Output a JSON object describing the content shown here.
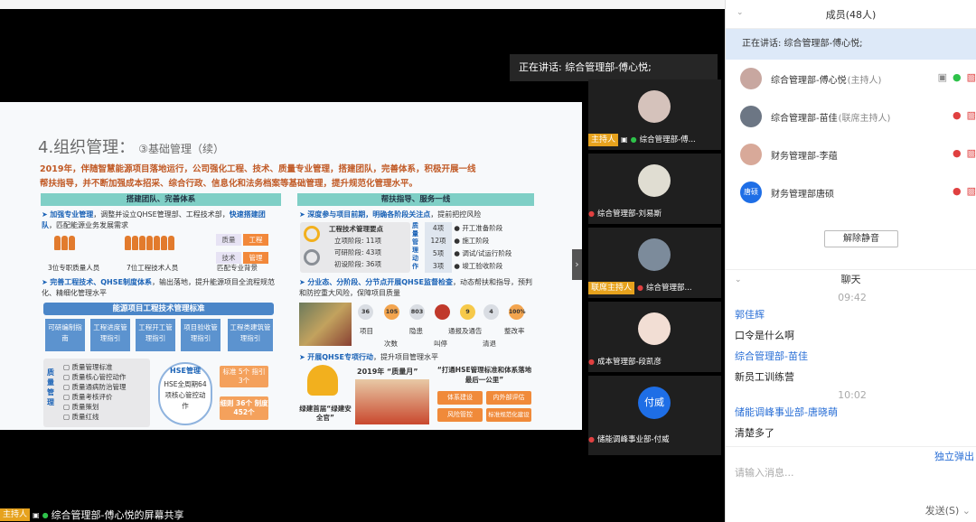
{
  "speaking_tip": "正在讲话: 综合管理部-傅心悦;",
  "slide": {
    "title_main": "4.组织管理：",
    "title_sub": "③基础管理（续）",
    "intro_lines": [
      "2019年，伴随智慧能源项目落地运行，公司强化工程、技术、质量专业管理，搭建团队，完善体系，积极开展一线",
      "帮扶指导，并不断加强成本招采、综合行政、信息化和法务档案等基础管理，提升规范化管理水平。"
    ],
    "left_head": "搭建团队、完善体系",
    "right_head": "帮扶指导、服务一线",
    "left_b1_key": "加强专业管理",
    "left_b1_rest": "，调整并设立QHSE管理部、工程技术部，",
    "left_b1_key2": "快速搭建团队",
    "left_b1_rest2": "，匹配能源业务发展需求",
    "stat1": "3位专职质量人员",
    "stat2": "7位工程技术人员",
    "stat3": "匹配专业背景",
    "skills": [
      "质量",
      "工程",
      "技术",
      "管理"
    ],
    "left_b2_key": "完善工程技术、QHSE制度体系",
    "left_b2_rest": "，输出落地，提升能源项目全流程规范化、精细化管理水平",
    "blue_header": "能源项目工程技术管理标准",
    "bars": [
      "可研编制指南",
      "工程进度管理指引",
      "工程开工管理指引",
      "项目验收管理指引",
      "工程类建筑管理指引"
    ],
    "quality_label": "质量管理",
    "quality_items": [
      "质量管理标准",
      "质量核心管控动作",
      "质量通病防治管理",
      "质量考核评价",
      "质量策划",
      "质量红线"
    ],
    "hse_title": "HSE管理",
    "hse_body": "HSE全周期64项核心管控动作",
    "std_badge": "标准 5个 指引 3个",
    "counts_badge": "细则 36个 制度 452个",
    "right_b1_key": "深度参与项目前期，明确各阶段关注点",
    "right_b1_rest": "，提前把控风险",
    "tech_title": "工程技术管理要点",
    "phases": [
      "立项阶段: 11项",
      "可研阶段: 43项",
      "初设阶段: 36项"
    ],
    "qc_label": "质量管理动作",
    "qc_counts": [
      "4项",
      "12项",
      "5项",
      "3项"
    ],
    "qc_stages": [
      "开工准备阶段",
      "施工阶段",
      "调试/试运行阶段",
      "竣工验收阶段"
    ],
    "right_b2_key": "分业态、分阶段、分节点开展QHSE监督检查",
    "right_b2_rest": "，动态帮扶和指导，预判和防控重大风险，保障项目质量",
    "circles": [
      "36",
      "105",
      "803",
      "?",
      "9",
      "4",
      "100%"
    ],
    "circle_labels": [
      "项目",
      "次数",
      "隐患",
      "叫停",
      "通报及通告",
      "通报及通告",
      "整改率"
    ],
    "circle_labels_row": [
      "项目",
      "次数",
      "隐患",
      "叫停",
      "通报及通告",
      "清退",
      "整改率"
    ],
    "right_b3_key": "开展QHSE专项行动",
    "right_b3_rest": "，提升项目管理水平",
    "quality_month": "2019年 “质量月”",
    "slogan": "“打通HSE管理标准和体系落地最后一公里”",
    "green_pills": [
      "体系建设",
      "内外部评估",
      "风险管控",
      "标准规范化建设"
    ],
    "firstline": "绿建首届“绿建安全官”"
  },
  "tiles": [
    {
      "name": "主持人",
      "label": "综合管理部-傅..."
    },
    {
      "name": "",
      "label": "综合管理部-刘易斯"
    },
    {
      "name": "联席主持人",
      "label": "综合管理部..."
    },
    {
      "name": "",
      "label": "成本管理部-段凯彦"
    },
    {
      "name": "",
      "label": "储能调峰事业部-付威",
      "avatar_text": "付威"
    }
  ],
  "bottom_label": "综合管理部-傅心悦的屏幕共享",
  "bottom_tag": "主持人",
  "members_panel": {
    "title": "成员(48人)",
    "speaking": "正在讲话: 综合管理部-傅心悦;",
    "members": [
      {
        "name": "综合管理部-傅心悦",
        "role": "(主持人)"
      },
      {
        "name": "综合管理部-苗佳",
        "role": "(联席主持人)"
      },
      {
        "name": "财务管理部-李蕴",
        "role": ""
      },
      {
        "name": "财务管理部唐硕",
        "role": "",
        "avatar_text": "唐硕"
      }
    ],
    "unmute_label": "解除静音"
  },
  "chat_panel": {
    "title": "聊天",
    "messages": [
      {
        "time": "09:42"
      },
      {
        "sender": "郭佳辉",
        "text": "口令是什么啊"
      },
      {
        "sender": "综合管理部-苗佳",
        "text": "新员工训练营"
      },
      {
        "time": "10:02"
      },
      {
        "sender": "储能调峰事业部-唐晓萌",
        "text": "清楚多了"
      }
    ],
    "popout_label": "独立弹出",
    "input_placeholder": "请输入消息...",
    "send_label": "发送(S)"
  }
}
